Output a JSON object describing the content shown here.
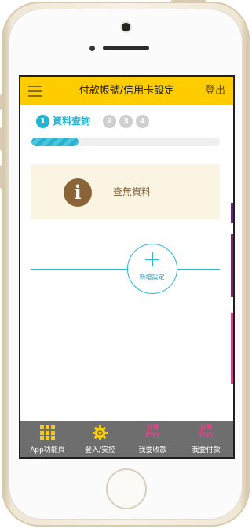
{
  "header": {
    "title": "付款帳號/信用卡設定",
    "logout_label": "登出"
  },
  "steps": {
    "active": {
      "number": "1",
      "label": "資料查詢"
    },
    "inactive": [
      "2",
      "3",
      "4"
    ]
  },
  "progress": {
    "fraction": 0.25
  },
  "info": {
    "icon": "info-icon",
    "message": "查無資料"
  },
  "add_button": {
    "label": "新增設定"
  },
  "tabs": [
    {
      "label": "App功能頁",
      "icon": "grid-icon"
    },
    {
      "label": "登入/安控",
      "icon": "gear-icon"
    },
    {
      "label": "我要收款",
      "icon": "taiwan-pay-icon",
      "icon_text_1": "台灣",
      "icon_text_2": "Pay"
    },
    {
      "label": "我要付款",
      "icon": "taiwan-pay-icon",
      "icon_text_1": "台灣",
      "icon_text_2": "Pay"
    }
  ],
  "colors": {
    "header": "#ffcc00",
    "accent": "#1fb5d4",
    "info_bg": "#fbf4e2",
    "tabbar": "#6e6e6e",
    "pay": "#e0438a"
  }
}
